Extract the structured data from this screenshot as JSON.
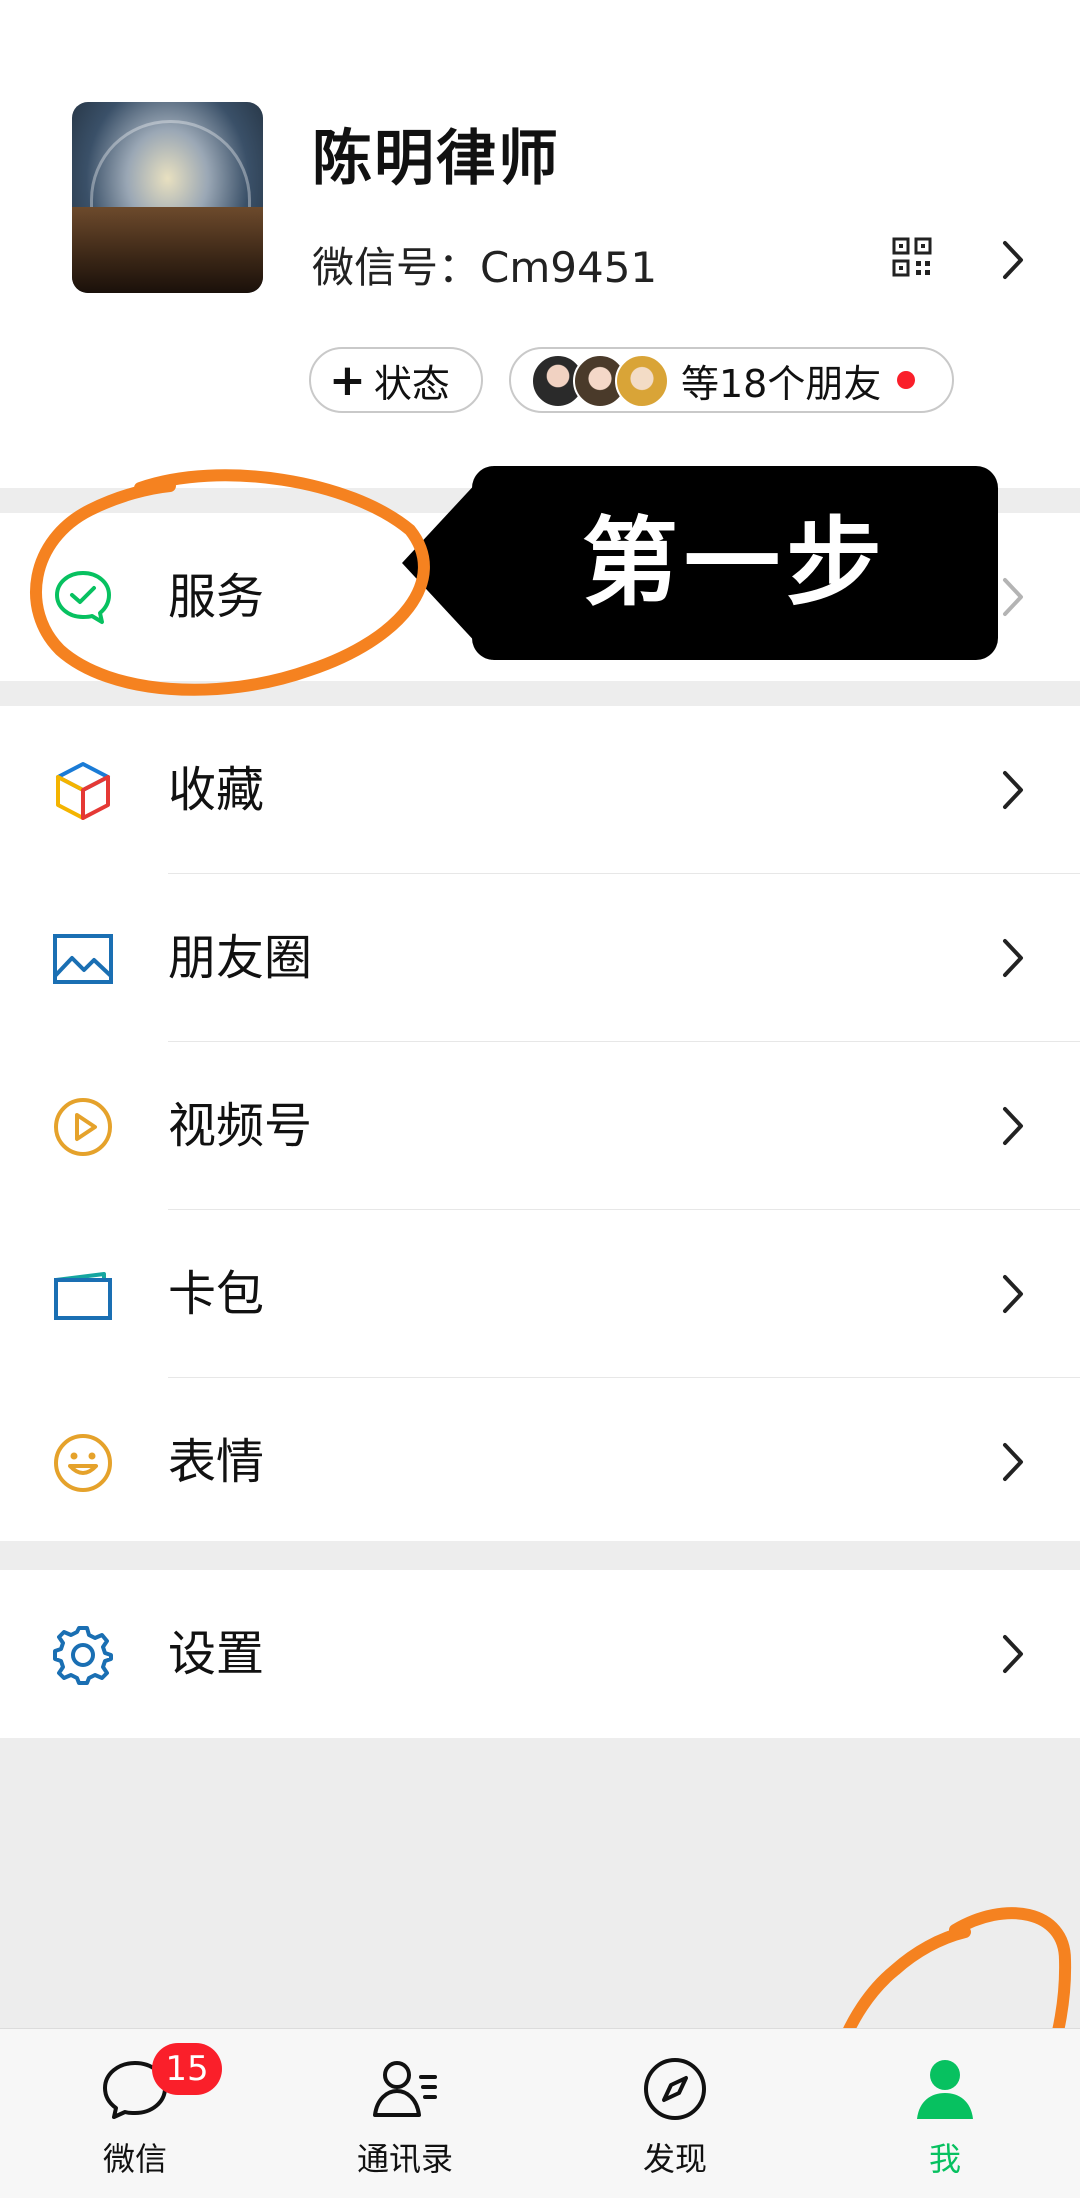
{
  "profile": {
    "name": "陈明律师",
    "wechat_id_label": "微信号：",
    "wechat_id": "Cm9451",
    "status_label": "状态",
    "friends_label": "等18个朋友"
  },
  "annotation": {
    "step_text": "第一步"
  },
  "menu": {
    "service": "服务",
    "favorites": "收藏",
    "moments": "朋友圈",
    "channels": "视频号",
    "cards": "卡包",
    "stickers": "表情",
    "settings": "设置"
  },
  "tabbar": {
    "chats": "微信",
    "chats_badge": "15",
    "contacts": "通讯录",
    "discover": "发现",
    "me": "我",
    "active_color": "#07c160"
  },
  "colors": {
    "wechat_green": "#07c160",
    "annotation_orange": "#f58220",
    "badge_red": "#fa1f2a"
  }
}
